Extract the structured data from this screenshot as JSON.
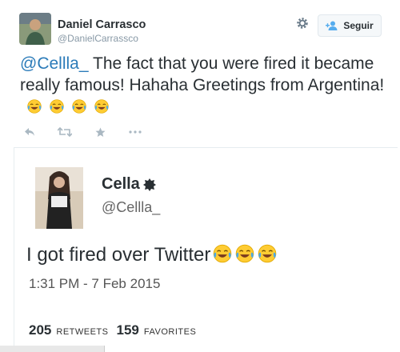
{
  "tweet": {
    "author_name": "Daniel Carrasco",
    "author_handle": "@DanielCarrassco",
    "follow_label": "Seguir",
    "mention": "@Cellla_",
    "text": " The fact that you were fired it became really famous! Hahaha Greetings from Argentina!",
    "emoji_count": 4,
    "icons": [
      "reply-icon",
      "retweet-icon",
      "favorite-icon",
      "more-icon"
    ]
  },
  "quoted": {
    "name": "Cella",
    "handle": "@Cellla_",
    "text": "I got fired over Twitter",
    "emoji_count": 3,
    "time": "1:31 PM - 7 Feb 2015",
    "retweets": "205",
    "retweets_label": "RETWEETS",
    "favorites": "159",
    "favorites_label": "FAVORITES"
  }
}
